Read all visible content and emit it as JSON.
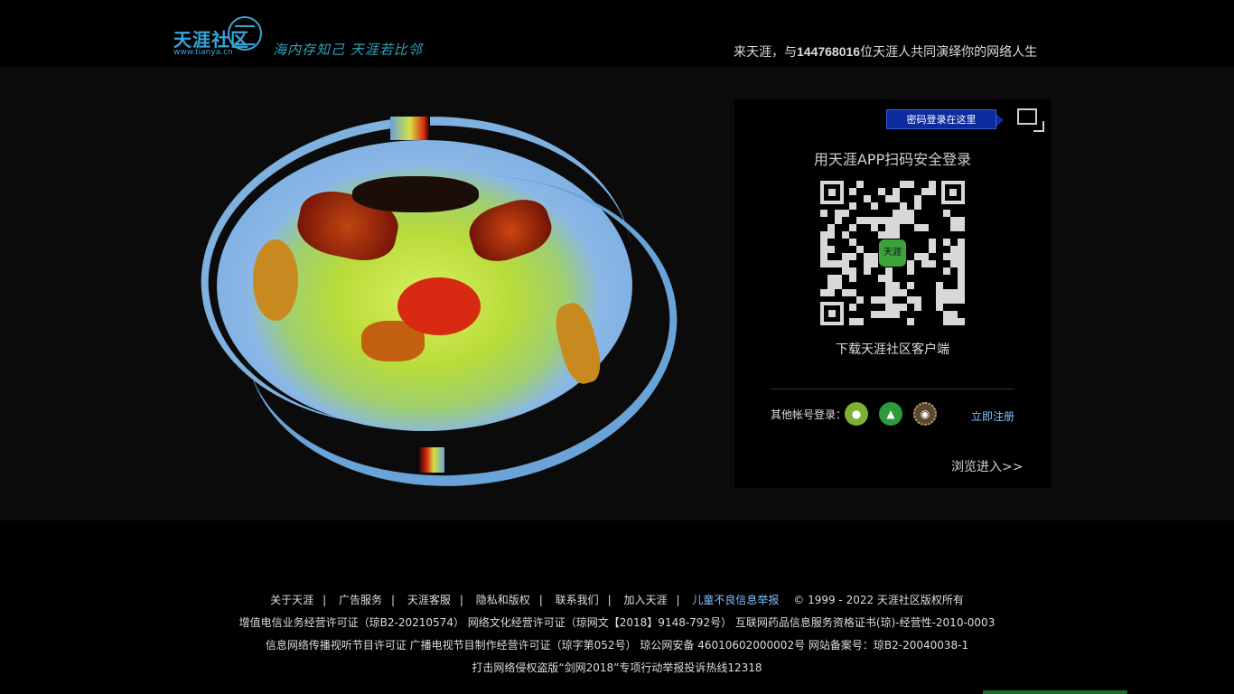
{
  "header": {
    "logo_cn": "天涯社区",
    "logo_en": "www.tianya.cn",
    "slogan": "海内存知己 天涯若比邻",
    "welcome_prefix": "来天涯，与",
    "user_count": "144768016",
    "welcome_suffix": "位天涯人共同演绎你的网络人生"
  },
  "login": {
    "password_tab": "密码登录在这里",
    "qr_title": "用天涯APP扫码安全登录",
    "qr_center": "天涯",
    "qr_caption": "下载天涯社区客户端",
    "other_login_label": "其他帐号登录：",
    "socials": [
      {
        "name": "wechat",
        "icon": "wechat-icon"
      },
      {
        "name": "qq",
        "icon": "qq-icon"
      },
      {
        "name": "weibo",
        "icon": "weibo-icon"
      }
    ],
    "register": "立即注册",
    "browse": "浏览进入>>"
  },
  "footer": {
    "links": [
      "关于天涯",
      "广告服务",
      "天涯客服",
      "隐私和版权",
      "联系我们",
      "加入天涯"
    ],
    "report": "儿童不良信息举报",
    "copyright": "© 1999 - 2022 天涯社区版权所有",
    "line1": "增值电信业务经营许可证（琼B2-20210574） 网络文化经营许可证（琼网文【2018】9148-792号） 互联网药品信息服务资格证书(琼)-经营性-2010-0003",
    "line2": "信息网络传播视听节目许可证  广播电视节目制作经营许可证（琼字第052号） 琼公网安备 46010602000002号  网站备案号：琼B2-20040038-1",
    "line3": "打击网络侵权盗版“剑网2018”专项行动举报投诉热线12318"
  },
  "colors": {
    "background": "#000000",
    "band": "#0b0b0b",
    "link_blue": "#7ec0ff",
    "logo_blue": "#3aa4d8",
    "password_tab": "#0d2b9e"
  }
}
